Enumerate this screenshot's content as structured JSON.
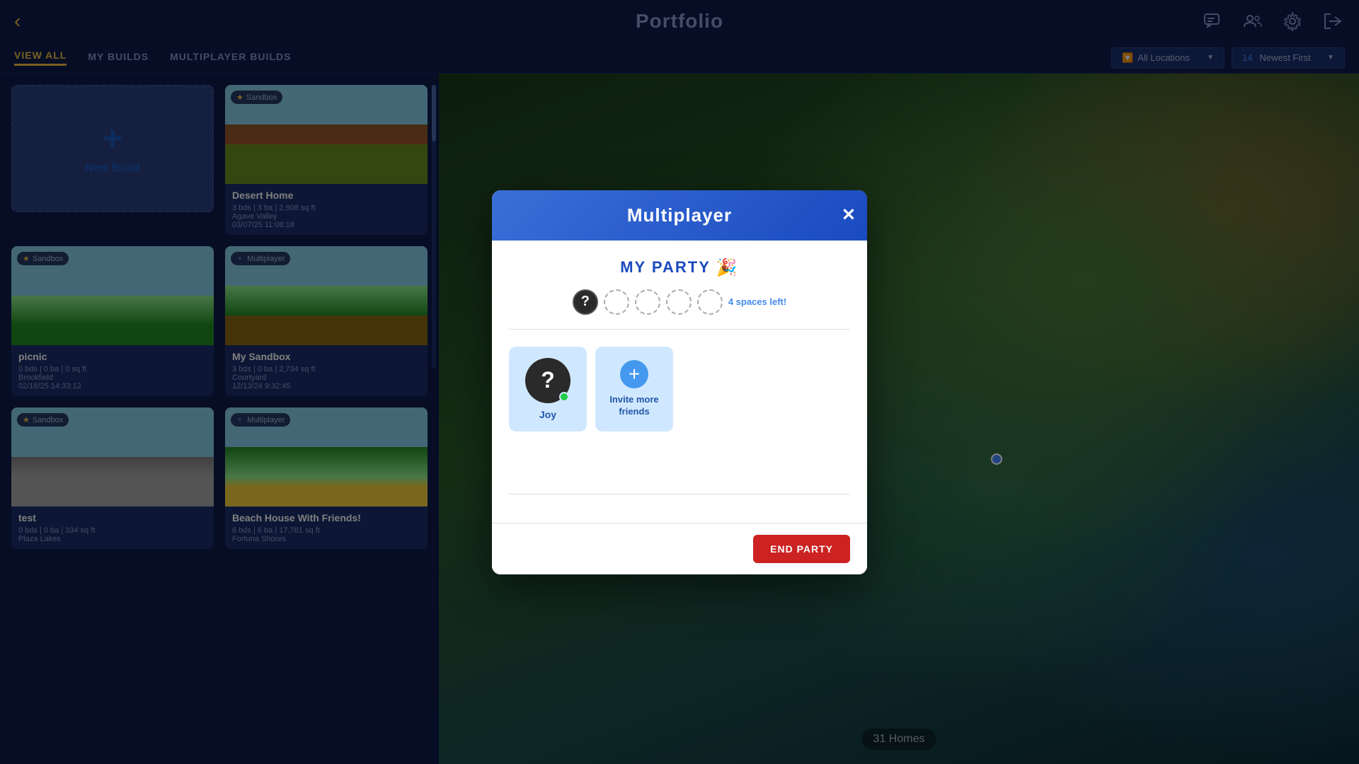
{
  "header": {
    "title": "Portfolio",
    "back_label": "‹",
    "icons": [
      {
        "name": "chat-icon",
        "symbol": "💬"
      },
      {
        "name": "group-icon",
        "symbol": "👥"
      },
      {
        "name": "settings-icon",
        "symbol": "⚙"
      },
      {
        "name": "logout-icon",
        "symbol": "→"
      }
    ]
  },
  "nav": {
    "tabs": [
      {
        "label": "VIEW ALL",
        "active": true
      },
      {
        "label": "MY BUILDS",
        "active": false
      },
      {
        "label": "MULTIPLAYER BUILDS",
        "active": false
      }
    ],
    "filters": {
      "location": {
        "label": "All Locations",
        "icon": "🔽"
      },
      "sort": {
        "label": "Newest First",
        "icon": "🔽",
        "prefix": "14"
      }
    }
  },
  "builds": [
    {
      "type": "new",
      "label": "New Build"
    },
    {
      "type": "card",
      "tag": "Sandbox",
      "title": "Desert Home",
      "details1": "3 bds | 3 ba | 2,908 sq ft",
      "details2": "Agave Valley",
      "details3": "03/07/25 11:08:18",
      "img": "desert"
    },
    {
      "type": "card",
      "tag": "Sandbox",
      "title": "picnic",
      "details1": "0 bds | 0 ba | 0 sq ft",
      "details2": "Brookfield",
      "details3": "02/16/25 14:33:12",
      "img": "picnic",
      "menu": true
    },
    {
      "type": "card",
      "tag": "Multiplayer",
      "title": "My Sandbox",
      "details1": "3 bds | 0 ba | 2,734 sq ft",
      "details2": "Courtyard",
      "details3": "12/13/24 9:32:45",
      "img": "my-sandbox"
    },
    {
      "type": "card",
      "tag": "Sandbox",
      "title": "test",
      "details1": "0 bds | 0 ba | 334 sq ft",
      "details2": "Plaza Lakes",
      "details3": "",
      "img": "test",
      "menu": true
    },
    {
      "type": "card",
      "tag": "Multiplayer",
      "title": "Beach House With Friends!",
      "details1": "6 bds | 6 ba | 17,761 sq ft",
      "details2": "Fortuna Shores",
      "details3": "",
      "img": "beach",
      "menu": true
    }
  ],
  "map": {
    "homes_count": "31 Homes"
  },
  "modal": {
    "title": "Multiplayer",
    "close_label": "✕",
    "party_label": "MY PARTY",
    "party_emoji": "🎉",
    "spaces_left": "4 spaces left!",
    "avatar_count": 5,
    "members": [
      {
        "name": "Joy",
        "avatar_symbol": "?",
        "online": true
      }
    ],
    "invite_label": "Invite more friends",
    "invite_plus": "+",
    "end_party_label": "END PARTY"
  }
}
